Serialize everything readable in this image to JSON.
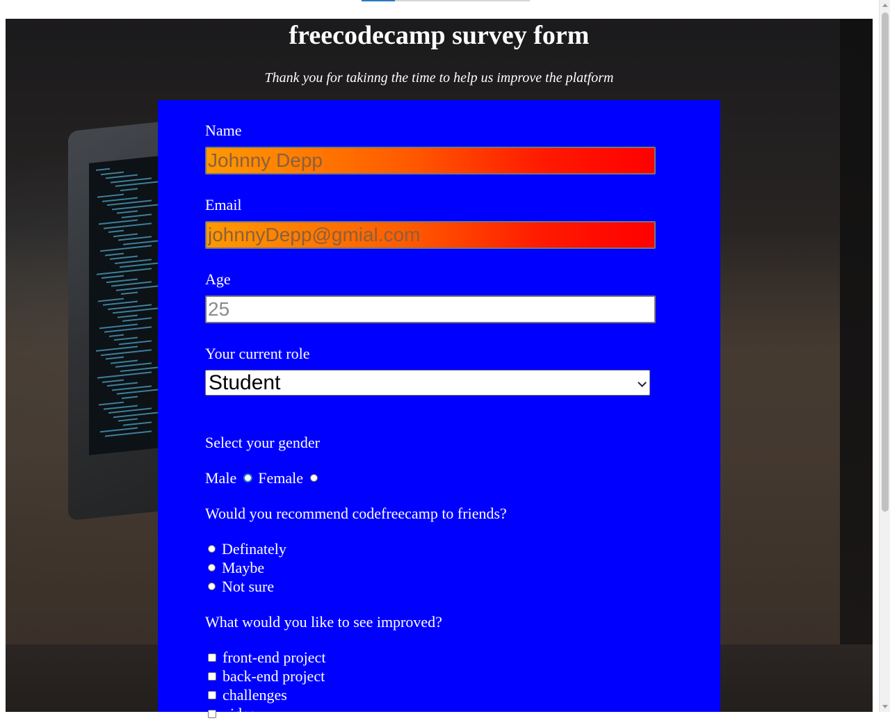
{
  "page": {
    "title": "freecodecamp survey form",
    "subtitle": "Thank you for takinng the time to help us improve the platform"
  },
  "form": {
    "name": {
      "label": "Name",
      "placeholder": "Johnny Depp"
    },
    "email": {
      "label": "Email",
      "placeholder": "johnnyDepp@gmial.com"
    },
    "age": {
      "label": "Age",
      "placeholder": "25"
    },
    "role": {
      "label": "Your current role",
      "selected": "Student"
    },
    "gender": {
      "label": "Select your gender",
      "options": [
        "Male",
        "Female"
      ]
    },
    "recommend": {
      "label": "Would you recommend codefreecamp to friends?",
      "options": [
        "Definately",
        "Maybe",
        "Not sure"
      ]
    },
    "improve": {
      "label": "What would you like to see improved?",
      "options": [
        "front-end project",
        "back-end project",
        "challenges",
        "video"
      ]
    }
  },
  "colors": {
    "form_background": "#0000ff",
    "input_gradient_start": "#ff9a00",
    "input_gradient_end": "#ff0000",
    "text": "#ffffff"
  },
  "icons": {
    "select": "chevron-down-icon"
  },
  "load_progress": 0.2
}
